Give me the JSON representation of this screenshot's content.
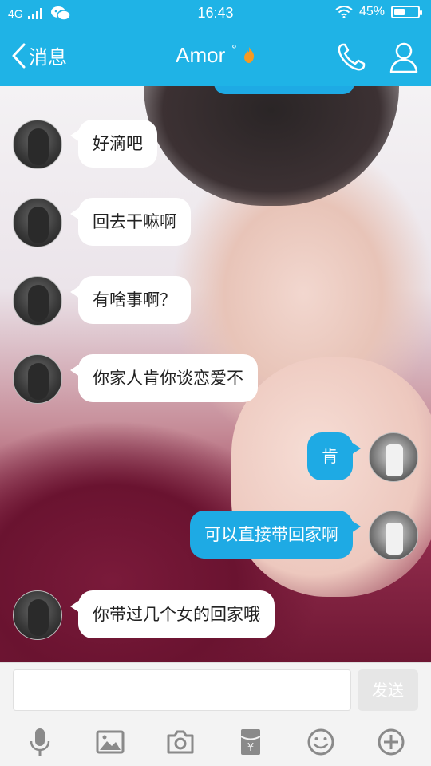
{
  "status": {
    "network": "4G",
    "time": "16:43",
    "battery_percent_text": "45%",
    "battery_level": 0.45
  },
  "header": {
    "back_label": "消息",
    "title": "Amor",
    "title_suffix": "°",
    "accent": "#1fb3e6"
  },
  "messages": [
    {
      "side": "in",
      "text": "好滴吧"
    },
    {
      "side": "in",
      "text": "回去干嘛啊"
    },
    {
      "side": "in",
      "text": "有啥事啊？"
    },
    {
      "side": "in",
      "text": "你家人肯你谈恋爱不"
    },
    {
      "side": "out",
      "text": "肯"
    },
    {
      "side": "out",
      "text": "可以直接带回家啊"
    },
    {
      "side": "in",
      "text": "你带过几个女的回家哦"
    }
  ],
  "input": {
    "placeholder": "",
    "send_label": "发送"
  },
  "toolbar": {
    "icons": [
      "microphone-icon",
      "image-icon",
      "camera-icon",
      "red-packet-icon",
      "emoji-icon",
      "plus-icon"
    ]
  }
}
